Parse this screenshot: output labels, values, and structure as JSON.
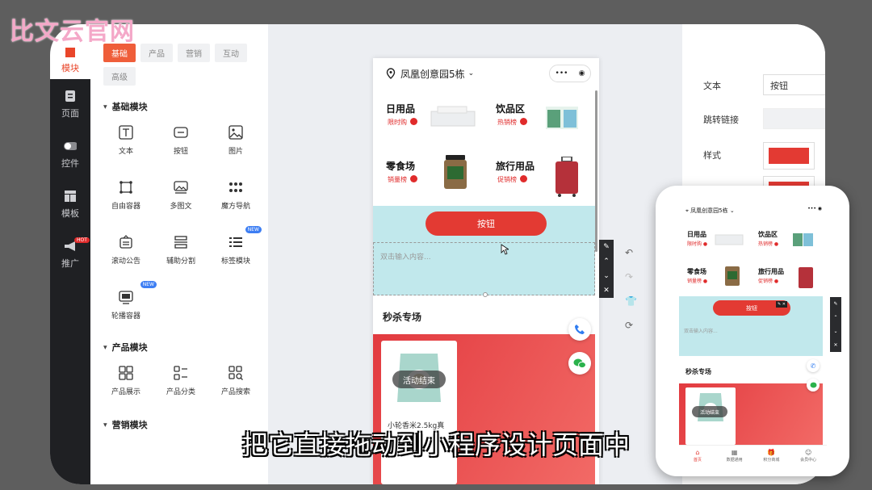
{
  "watermark": "比文云官网",
  "rail": {
    "items": [
      {
        "label": "模块",
        "icon": "module-icon"
      },
      {
        "label": "页面",
        "icon": "page-icon"
      },
      {
        "label": "控件",
        "icon": "toggle-icon"
      },
      {
        "label": "模板",
        "icon": "template-icon"
      },
      {
        "label": "推广",
        "icon": "megaphone-icon",
        "badge": "HOT"
      }
    ]
  },
  "library": {
    "tabs": [
      "基础",
      "产品",
      "营销",
      "互动",
      "高级"
    ],
    "sections": [
      {
        "title": "基础模块",
        "items": [
          {
            "label": "文本",
            "icon": "text-icon"
          },
          {
            "label": "按钮",
            "icon": "button-icon"
          },
          {
            "label": "图片",
            "icon": "image-icon"
          },
          {
            "label": "自由容器",
            "icon": "free-container-icon"
          },
          {
            "label": "多图文",
            "icon": "multi-image-text-icon"
          },
          {
            "label": "魔方导航",
            "icon": "grid-nav-icon"
          },
          {
            "label": "滚动公告",
            "icon": "notice-icon"
          },
          {
            "label": "辅助分割",
            "icon": "divider-icon"
          },
          {
            "label": "标签模块",
            "icon": "tag-module-icon",
            "badge": "NEW"
          },
          {
            "label": "轮播容器",
            "icon": "carousel-icon",
            "badge": "NEW"
          }
        ]
      },
      {
        "title": "产品模块",
        "items": [
          {
            "label": "产品展示",
            "icon": "product-display-icon"
          },
          {
            "label": "产品分类",
            "icon": "product-category-icon"
          },
          {
            "label": "产品搜索",
            "icon": "product-search-icon"
          }
        ]
      },
      {
        "title": "营销模块",
        "items": []
      }
    ]
  },
  "phone": {
    "location": "凤凰创意园5栋",
    "categories": [
      {
        "name": "日用品",
        "tag": "限时购"
      },
      {
        "name": "饮品区",
        "tag": "热销榜"
      },
      {
        "name": "零食场",
        "tag": "销量榜"
      },
      {
        "name": "旅行用品",
        "tag": "促销榜"
      }
    ],
    "button_label": "按钮",
    "text_placeholder": "双击输入内容...",
    "seckill_title": "秒杀专场",
    "ended_label": "活动结束",
    "product_name": "小轮香米2.5kg真"
  },
  "props": {
    "text_label": "文本",
    "text_value": "按钮",
    "link_label": "跳转链接",
    "style_label": "样式",
    "color": "#e33a33"
  },
  "preview": {
    "location": "凤凰创意园5栋",
    "seckill_title": "秒杀专场",
    "ended_label": "活动结束",
    "text_placeholder": "双击输入内容...",
    "button_label": "按钮",
    "tabs": [
      "首页",
      "数据通用",
      "积分商城",
      "会员中心"
    ]
  },
  "caption": "把它直接拖动到小程序设计页面中"
}
